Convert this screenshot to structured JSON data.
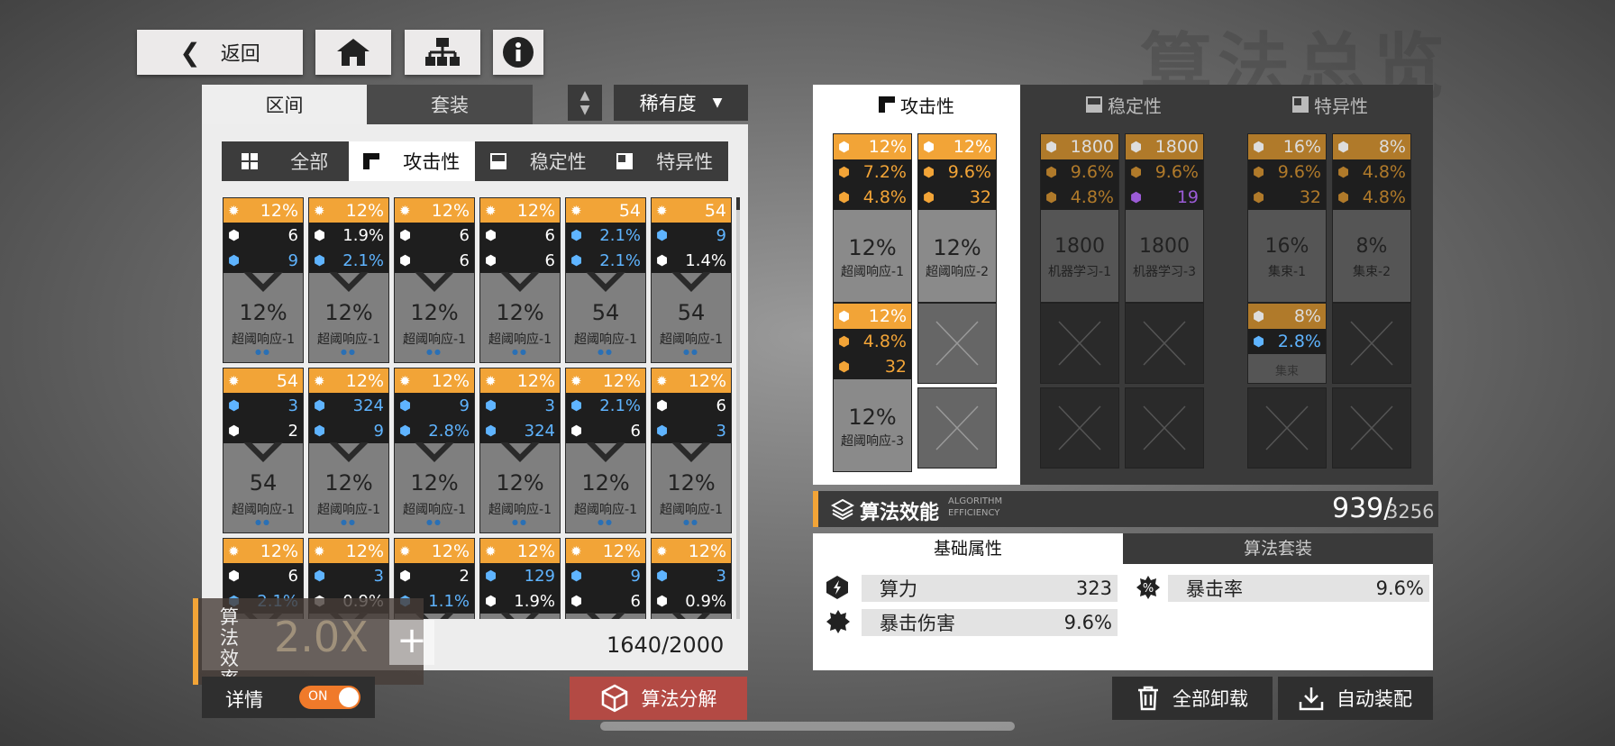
{
  "header": {
    "back_label": "返回",
    "bg_title": "算法总览"
  },
  "left": {
    "tabs": [
      "区间",
      "套装"
    ],
    "sort_label": "稀有度",
    "filters": [
      "全部",
      "攻击性",
      "稳定性",
      "特异性"
    ],
    "count": "1640/2000",
    "rate_label": "算法效率",
    "rate_value": "2.0X",
    "detail_label": "详情",
    "toggle": "ON",
    "decompose_label": "算法分解"
  },
  "chips": [
    {
      "top": "12%",
      "s1": "6",
      "s2": "9",
      "s2b": true,
      "main": "12%",
      "name": "超阈响应-1"
    },
    {
      "top": "12%",
      "s1": "1.9%",
      "s2": "2.1%",
      "s2b": true,
      "main": "12%",
      "name": "超阈响应-1"
    },
    {
      "top": "12%",
      "s1": "6",
      "s2": "6",
      "s2b": false,
      "main": "12%",
      "name": "超阈响应-1"
    },
    {
      "top": "12%",
      "s1": "6",
      "s2": "6",
      "s2b": false,
      "main": "12%",
      "name": "超阈响应-1"
    },
    {
      "top": "54",
      "s1": "2.1%",
      "s1b": true,
      "s2": "2.1%",
      "s2b": true,
      "main": "54",
      "name": "超阈响应-1"
    },
    {
      "top": "54",
      "s1": "9",
      "s1b": true,
      "s2": "1.4%",
      "s2b": false,
      "main": "54",
      "name": "超阈响应-1"
    },
    {
      "top": "54",
      "s1": "3",
      "s1b": true,
      "s2": "2",
      "s2b": false,
      "main": "54",
      "name": "超阈响应-1"
    },
    {
      "top": "12%",
      "s1": "324",
      "s1b": true,
      "s2": "9",
      "s2b": true,
      "main": "12%",
      "name": "超阈响应-1"
    },
    {
      "top": "12%",
      "s1": "9",
      "s1b": true,
      "s2": "2.8%",
      "s2b": true,
      "main": "12%",
      "name": "超阈响应-1"
    },
    {
      "top": "12%",
      "s1": "3",
      "s1b": true,
      "s2": "324",
      "s2b": true,
      "main": "12%",
      "name": "超阈响应-1"
    },
    {
      "top": "12%",
      "s1": "2.1%",
      "s1b": true,
      "s2": "6",
      "s2b": false,
      "main": "12%",
      "name": "超阈响应-1"
    },
    {
      "top": "12%",
      "s1": "6",
      "s2": "3",
      "s2b": true,
      "main": "12%",
      "name": "超阈响应-1"
    },
    {
      "top": "12%",
      "s1": "6",
      "s2": "2.1%",
      "s2b": true
    },
    {
      "top": "12%",
      "s1": "3",
      "s1b": true,
      "s2": "0.9%",
      "s2b": false
    },
    {
      "top": "12%",
      "s1": "2",
      "s2": "1.1%",
      "s2b": true
    },
    {
      "top": "12%",
      "s1": "129",
      "s1b": true,
      "s2": "1.9%",
      "s2b": false
    },
    {
      "top": "12%",
      "s1": "9",
      "s1b": true,
      "s2": "6",
      "s2b": false
    },
    {
      "top": "12%",
      "s1": "3",
      "s1b": true,
      "s2": "0.9%",
      "s2b": false
    }
  ],
  "right": {
    "tabs": [
      "攻击性",
      "稳定性",
      "特异性"
    ],
    "atk": [
      {
        "lines": [
          "12%",
          "7.2%",
          "4.8%"
        ],
        "main": "12%",
        "name": "超阈响应-1"
      },
      {
        "lines": [
          "12%",
          "9.6%",
          "32"
        ],
        "main": "12%",
        "name": "超阈响应-2"
      },
      {
        "lines": [
          "12%",
          "4.8%",
          "32"
        ],
        "main": "12%",
        "name": "超阈响应-3"
      }
    ],
    "stb": [
      {
        "lines": [
          "1800",
          "9.6%",
          "4.8%"
        ],
        "main": "1800",
        "name": "机器学习-1"
      },
      {
        "lines": [
          "1800",
          "9.6%",
          "19"
        ],
        "main": "1800",
        "name": "机器学习-3"
      }
    ],
    "spc": [
      {
        "lines": [
          "16%",
          "9.6%",
          "32"
        ],
        "main": "16%",
        "name": "集束-1"
      },
      {
        "lines": [
          "8%",
          "4.8%",
          "4.8%"
        ],
        "main": "8%",
        "name": "集束-2"
      },
      {
        "lines": [
          "8%",
          "2.8%"
        ],
        "name": "集束"
      }
    ],
    "eff_label": "算法效能",
    "eff_sub1": "ALGORITHM",
    "eff_sub2": "EFFICIENCY",
    "eff_value": "939/",
    "eff_total": "3256",
    "attr_tabs": [
      "基础属性",
      "算法套装"
    ],
    "attrs": [
      {
        "label": "算力",
        "value": "323"
      },
      {
        "label": "暴击率",
        "value": "9.6%"
      },
      {
        "label": "暴击伤害",
        "value": "9.6%"
      }
    ],
    "unload_label": "全部卸载",
    "auto_label": "自动装配"
  },
  "colors": {
    "accent": "#f2a437",
    "blue": "#5fb4ff",
    "red": "#b34a44",
    "purple": "#9b5bd6"
  }
}
